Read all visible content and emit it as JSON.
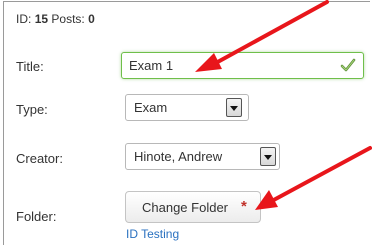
{
  "meta": {
    "id_label": "ID:",
    "id_value": "15",
    "posts_label": "Posts:",
    "posts_value": "0"
  },
  "form": {
    "title": {
      "label": "Title:",
      "value": "Exam 1",
      "status_icon": "check-icon"
    },
    "type": {
      "label": "Type:",
      "selected": "Exam"
    },
    "creator": {
      "label": "Creator:",
      "selected": "Hinote, Andrew"
    },
    "folder": {
      "label": "Folder:",
      "button_label": "Change Folder",
      "required_mark": "*",
      "current_folder": "ID Testing"
    }
  },
  "annotations": {
    "arrow_color": "#e8161b",
    "arrows": [
      "arrow-to-title-field",
      "arrow-to-change-folder-button"
    ]
  },
  "colors": {
    "valid_border": "#6fbf4a",
    "required": "#c0312a",
    "link": "#2a71c0"
  }
}
